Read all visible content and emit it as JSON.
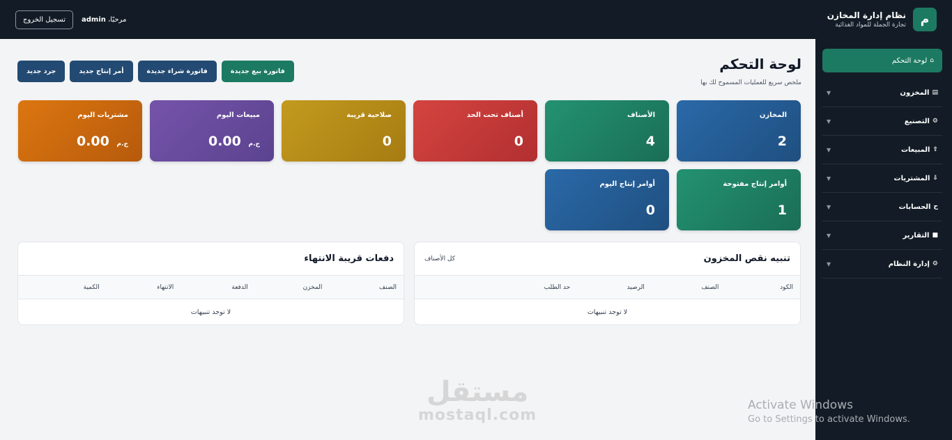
{
  "brand": {
    "logo_letter": "م",
    "title": "نظام إدارة المخازن",
    "subtitle": "تجارة الجملة للمواد الغذائية"
  },
  "user": {
    "welcome_prefix": "مرحبًا،",
    "username": "admin",
    "logout_label": "تسجيل الخروج"
  },
  "sidebar": {
    "active": {
      "icon": "⌂",
      "label": "لوحة التحكم"
    },
    "items": [
      {
        "icon": "▤",
        "label": "المخزون"
      },
      {
        "icon": "⚙",
        "label": "التصنيع"
      },
      {
        "icon": "⇧",
        "label": "المبيعات"
      },
      {
        "icon": "⇩",
        "label": "المشتريات"
      },
      {
        "icon": "ح",
        "label": "الحسابات"
      },
      {
        "icon": "■",
        "label": "التقارير"
      },
      {
        "icon": "⚙",
        "label": "إدارة النظام"
      }
    ]
  },
  "page": {
    "title": "لوحة التحكم",
    "subtitle": "ملخص سريع للعمليات المسموح لك بها"
  },
  "actions": {
    "new_inventory": "جرد جديد",
    "new_production": "أمر إنتاج جديد",
    "new_purchase": "فاتورة شراء جديدة",
    "new_sale": "فاتورة بيع جديدة"
  },
  "cards": {
    "warehouses": {
      "label": "المخازن",
      "value": "2"
    },
    "items": {
      "label": "الأصناف",
      "value": "4"
    },
    "below_limit": {
      "label": "أصناف تحت الحد",
      "value": "0"
    },
    "near_expiry": {
      "label": "صلاحية قريبة",
      "value": "0"
    },
    "sales_today": {
      "label": "مبيعات اليوم",
      "value": "0.00",
      "unit": "ج.م"
    },
    "purchases_today": {
      "label": "مشتريات اليوم",
      "value": "0.00",
      "unit": "ج.م"
    },
    "open_production": {
      "label": "أوامر إنتاج مفتوحة",
      "value": "1"
    },
    "production_today": {
      "label": "أوامر إنتاج اليوم",
      "value": "0"
    }
  },
  "stock_alert": {
    "title": "تنبيه نقص المخزون",
    "link": "كل الأصناف",
    "columns": [
      "الكود",
      "الصنف",
      "الرصيد",
      "حد الطلب"
    ],
    "empty": "لا توجد تنبيهات"
  },
  "expiry": {
    "title": "دفعات قريبة الانتهاء",
    "columns": [
      "الصنف",
      "المخزن",
      "الدفعة",
      "الانتهاء",
      "الكمية"
    ],
    "empty": "لا توجد تنبيهات"
  },
  "watermark": {
    "arabic": "مستقل",
    "latin": "mostaql.com"
  },
  "windows_notice": {
    "line1": "Activate Windows",
    "line2": "Go to Settings to activate Windows."
  },
  "colors": {
    "topbar": "#131c26",
    "accent_green": "#1d7a62",
    "navy": "#234a72",
    "card_blue": "#245c95",
    "card_green": "#1f7e63",
    "card_red": "#c9393a",
    "card_gold": "#b78b1a",
    "card_purple": "#6a4ea0",
    "card_orange": "#cf6a0d"
  }
}
